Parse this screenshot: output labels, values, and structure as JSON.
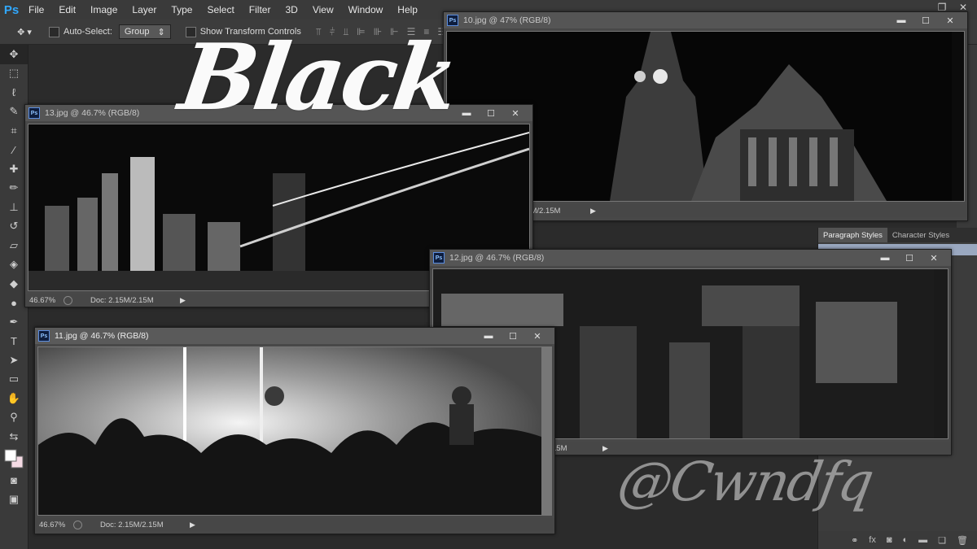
{
  "menubar": {
    "logo": "Ps",
    "items": [
      "File",
      "Edit",
      "Image",
      "Layer",
      "Type",
      "Select",
      "Filter",
      "3D",
      "View",
      "Window",
      "Help"
    ]
  },
  "options": {
    "auto_select_label": "Auto-Select:",
    "auto_select_value": "Group",
    "show_transform_label": "Show Transform Controls"
  },
  "overlay": {
    "title": "Black",
    "handle": "@Cwndfq"
  },
  "docs": {
    "doc10": {
      "title": "10.jpg @ 47% (RGB/8)",
      "zoom": "",
      "docsize": "2.15M/2.15M"
    },
    "doc13": {
      "title": "13.jpg @ 46.7% (RGB/8)",
      "zoom": "46.67%",
      "docsize": "Doc: 2.15M/2.15M"
    },
    "doc12": {
      "title": "12.jpg @ 46.7% (RGB/8)",
      "zoom": "",
      "docsize": "15M"
    },
    "doc11": {
      "title": "11.jpg @ 46.7% (RGB/8)",
      "zoom": "46.67%",
      "docsize": "Doc: 2.15M/2.15M"
    }
  },
  "panels": {
    "tabs": [
      "Paragraph Styles",
      "Character Styles"
    ]
  },
  "colors": {
    "accent": "#31a8ff",
    "background": "#2b2b2b",
    "panel": "#3a3a3a"
  }
}
